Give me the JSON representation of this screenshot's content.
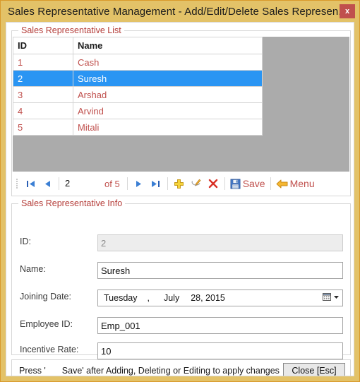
{
  "window": {
    "title": "Sales Representative Management - Add/Edit/Delete Sales Represen...",
    "close_label": "x",
    "border_color": "#E3C268",
    "accent_color": "#C0504D"
  },
  "list_group": {
    "legend": "Sales Representative List",
    "columns": [
      "ID",
      "Name"
    ],
    "rows": [
      {
        "id": "1",
        "name": "Cash",
        "selected": false
      },
      {
        "id": "2",
        "name": "Suresh",
        "selected": true
      },
      {
        "id": "3",
        "name": "Arshad",
        "selected": false
      },
      {
        "id": "4",
        "name": "Arvind",
        "selected": false
      },
      {
        "id": "5",
        "name": "Mitali",
        "selected": false
      }
    ],
    "selection_color": "#2A95F3",
    "row_text_color": "#C0504D",
    "empty_area_color": "#ABABAB"
  },
  "navigator": {
    "first_icon": "first-page-icon",
    "prev_icon": "previous-page-icon",
    "page_value": "2",
    "page_total_label": "of 5",
    "next_icon": "next-page-icon",
    "last_icon": "last-page-icon",
    "add_icon": "add-plus-icon",
    "edit_icon": "edit-pencil-icon",
    "delete_icon": "delete-cross-icon",
    "save_icon": "save-floppy-icon",
    "save_label": "Save",
    "menu_icon": "back-arrow-icon",
    "menu_label": "Menu"
  },
  "info_group": {
    "legend": "Sales Representative Info",
    "fields": [
      {
        "label": "ID:",
        "value": "2",
        "disabled": true
      },
      {
        "label": "Name:",
        "value": "Suresh",
        "disabled": false
      },
      {
        "label": "Employee ID:",
        "value": "Emp_001",
        "disabled": false
      },
      {
        "label": "Incentive Rate:",
        "value": "10",
        "disabled": false
      }
    ],
    "date_field": {
      "label": "Joining Date:",
      "weekday": "Tuesday",
      "comma": ",",
      "month": "July",
      "day_year": "28, 2015",
      "dropdown_icon": "calendar-dropdown-icon"
    }
  },
  "statusbar": {
    "text_part1": "Press '",
    "text_part2": "Save' after Adding, Deleting or Editing to apply changes",
    "close_button_label": "Close [Esc]"
  }
}
